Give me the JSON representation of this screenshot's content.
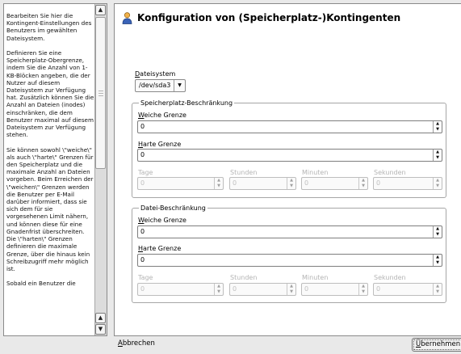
{
  "help": {
    "text": "Bearbeiten Sie hier die Kontingent-Einstellungen des Benutzers im gewählten Dateisystem.\n\nDefinieren Sie eine Speicherplatz-Obergrenze, indem Sie die Anzahl von 1-KB-Blöcken angeben, die der Nutzer auf diesem Dateisystem zur Verfügung hat. Zusätzlich können Sie die Anzahl an Dateien (inodes) einschränken, die dem Benutzer maximal auf diesem Dateisystem zur Verfügung stehen.\n\nSie können sowohl \\\"weiche\\\" als auch \\\"harte\\\" Grenzen für den Speicherplatz und die maximale Anzahl an Dateien vorgeben. Beim Erreichen der \\\"weichen\\\" Grenzen werden die Benutzer per E-Mail darüber informiert, dass sie sich dem für sie vorgesehenen Limit nähern, und können diese für eine Gnadenfrist überschreiten. Die \\\"harten\\\" Grenzen definieren die maximale Grenze, über die hinaus kein Schreibzugriff mehr möglich ist.\n\nSobald ein Benutzer die"
  },
  "title": "Konfiguration von (Speicherplatz-)Kontingenten",
  "filesystem": {
    "label_u": "D",
    "label_rest": "ateisystem",
    "value": "/dev/sda3"
  },
  "space": {
    "legend": "Speicherplatz-Beschränkung",
    "soft_u": "W",
    "soft_rest": "eiche Grenze",
    "soft_value": "0",
    "hard_u": "H",
    "hard_rest": "arte Grenze",
    "hard_value": "0",
    "days": "Tage",
    "hours": "Stunden",
    "minutes": "Minuten",
    "seconds": "Sekunden",
    "days_value": "0",
    "hours_value": "0",
    "minutes_value": "0",
    "seconds_value": "0"
  },
  "files": {
    "legend": "Datei-Beschränkung",
    "soft_u": "W",
    "soft_rest": "eiche Grenze",
    "soft_value": "0",
    "hard_u": "H",
    "hard_rest": "arte Grenze",
    "hard_value": "0",
    "days": "Tage",
    "hours": "Stunden",
    "minutes": "Minuten",
    "seconds": "Sekunden",
    "days_value": "0",
    "hours_value": "0",
    "minutes_value": "0",
    "seconds_value": "0"
  },
  "buttons": {
    "cancel_u": "A",
    "cancel_rest": "bbrechen",
    "accept_u": "Ü",
    "accept_rest": "bernehmen"
  },
  "icons": {
    "title": "user-icon",
    "scroll_up": "arrow-up-icon",
    "scroll_down": "arrow-down-icon",
    "combo": "chevron-down-icon",
    "spin": "spin-arrows-icon"
  },
  "colors": {
    "window_bg": "#e9e9e9",
    "panel_bg": "#ffffff"
  }
}
